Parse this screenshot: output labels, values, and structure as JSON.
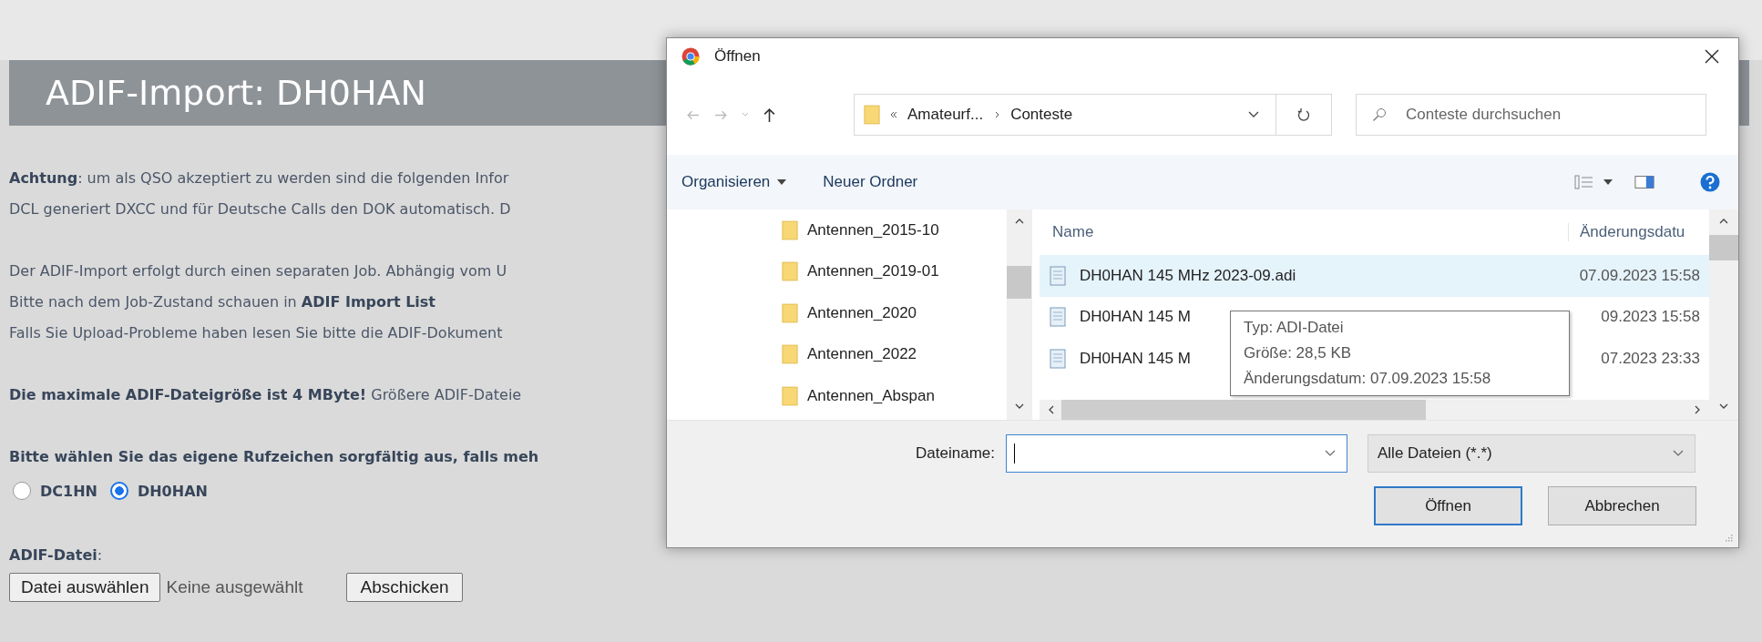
{
  "page": {
    "title": "ADIF-Import: DH0HAN",
    "paragraphs": [
      {
        "lines": [
          "**Achtung**: um als QSO akzeptiert zu werden sind die folgenden Infor",
          "DCL generiert DXCC und für Deutsche Calls den DOK automatisch. D"
        ]
      },
      {
        "lines": [
          "Der ADIF-Import erfolgt durch einen separaten Job. Abhängig vom U",
          "Bitte nach dem Job-Zustand schauen in **ADIF Import List**",
          "Falls Sie Upload-Probleme haben lesen Sie bitte die ADIF-Dokument"
        ]
      },
      {
        "lines": [
          "**Die maximale ADIF-Dateigröße ist 4 MByte!** Größere ADIF-Dateie"
        ]
      }
    ],
    "callsign_prompt": "Bitte wählen Sie das eigene Rufzeichen sorgfältig aus, falls meh",
    "callsigns": [
      {
        "label": "DC1HN",
        "selected": false
      },
      {
        "label": "DH0HAN",
        "selected": true
      }
    ],
    "file_label": "**ADIF-Datei**:",
    "choose_button": "Datei auswählen",
    "no_file": "Keine ausgewählt",
    "submit_button": "Abschicken"
  },
  "dialog": {
    "title": "Öffnen",
    "path": [
      "Amateurf...",
      "Conteste"
    ],
    "search": {
      "placeholder": "Conteste durchsuchen"
    },
    "toolbar": [
      {
        "label": "Organisieren",
        "kind": "menu"
      },
      {
        "label": "Neuer Ordner",
        "kind": "action"
      }
    ],
    "folders": [
      "Antennen_2015-10",
      "Antennen_2019-01",
      "Antennen_2020",
      "Antennen_2022",
      "Antennen_Abspan"
    ],
    "columns": [
      "Name",
      "Änderungsdatu"
    ],
    "files": [
      {
        "name": "DH0HAN 145 MHz 2023-09.adi",
        "date": "07.09.2023 15:58",
        "selected": true
      },
      {
        "name": "DH0HAN 145 M",
        "date": "09.2023 15:58",
        "selected": false
      },
      {
        "name": "DH0HAN 145 M",
        "date": "07.2023 23:33",
        "selected": false
      }
    ],
    "tooltip": [
      "Typ: ADI-Datei",
      "Größe: 28,5 KB",
      "Änderungsdatum: 07.09.2023 15:58"
    ],
    "filename_label": "Dateiname:",
    "filter": "Alle Dateien (*.*)",
    "buttons": [
      {
        "label": "Öffnen",
        "default": true
      },
      {
        "label": "Abbrechen",
        "default": false
      }
    ]
  }
}
